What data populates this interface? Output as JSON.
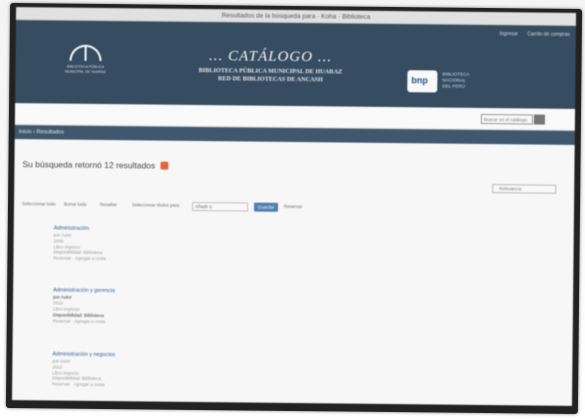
{
  "window": {
    "title": "Resultados de la búsqueda para · Koha · Biblioteca"
  },
  "header": {
    "top_links": [
      "Ingresar",
      "Carrito de compras"
    ],
    "logo_caption": "BIBLIOTECA PÚBLICA MUNICIPAL DE HUARAZ",
    "catalog_title": "... CATÁLOGO ...",
    "subtitle_1": "BIBLIOTECA PÚBLICA MUNICIPAL DE HUARAZ",
    "subtitle_2": "RED DE BIBLIOTECAS DE ANCASH",
    "bnp_logo": "bnp",
    "bnp_caption": [
      "BIBLIOTECA",
      "NACIONAL",
      "DEL PERÚ"
    ]
  },
  "search": {
    "placeholder": "Buscar en el catálogo",
    "button_icon": "search-icon"
  },
  "breadcrumb": "Inicio › Resultados",
  "results": {
    "heading": "Su búsqueda retornó 12 resultados",
    "sort_label": "Relevancia",
    "toolbar": {
      "select_all": "Seleccionar todo",
      "clear_all": "Borrar todo",
      "highlight": "Resaltar",
      "select_titles": "Seleccionar títulos para:",
      "action": "Añadir a",
      "save_button": "Guardar",
      "place_hold": "Reservar"
    },
    "items": [
      {
        "title": "Administración",
        "author": "por Autor",
        "year": "2008",
        "material": "Libro impreso",
        "availability": "Disponibilidad: Biblioteca",
        "actions": "Reservar · Agregar a cesta"
      },
      {
        "title": "Administración y gerencia",
        "author": "por Autor",
        "year": "2010",
        "material": "Libro impreso",
        "availability": "Disponibilidad: Biblioteca",
        "actions": "Reservar · Agregar a cesta"
      },
      {
        "title": "Administración y negocios",
        "author": "por Autor",
        "year": "2012",
        "material": "Libro impreso",
        "availability": "Disponibilidad: Biblioteca",
        "actions": "Reservar · Agregar a cesta"
      }
    ]
  },
  "colors": {
    "banner": "#31495f",
    "breadcrumb": "#3d566d",
    "link": "#2a5e9a",
    "rss": "#e8643f"
  }
}
